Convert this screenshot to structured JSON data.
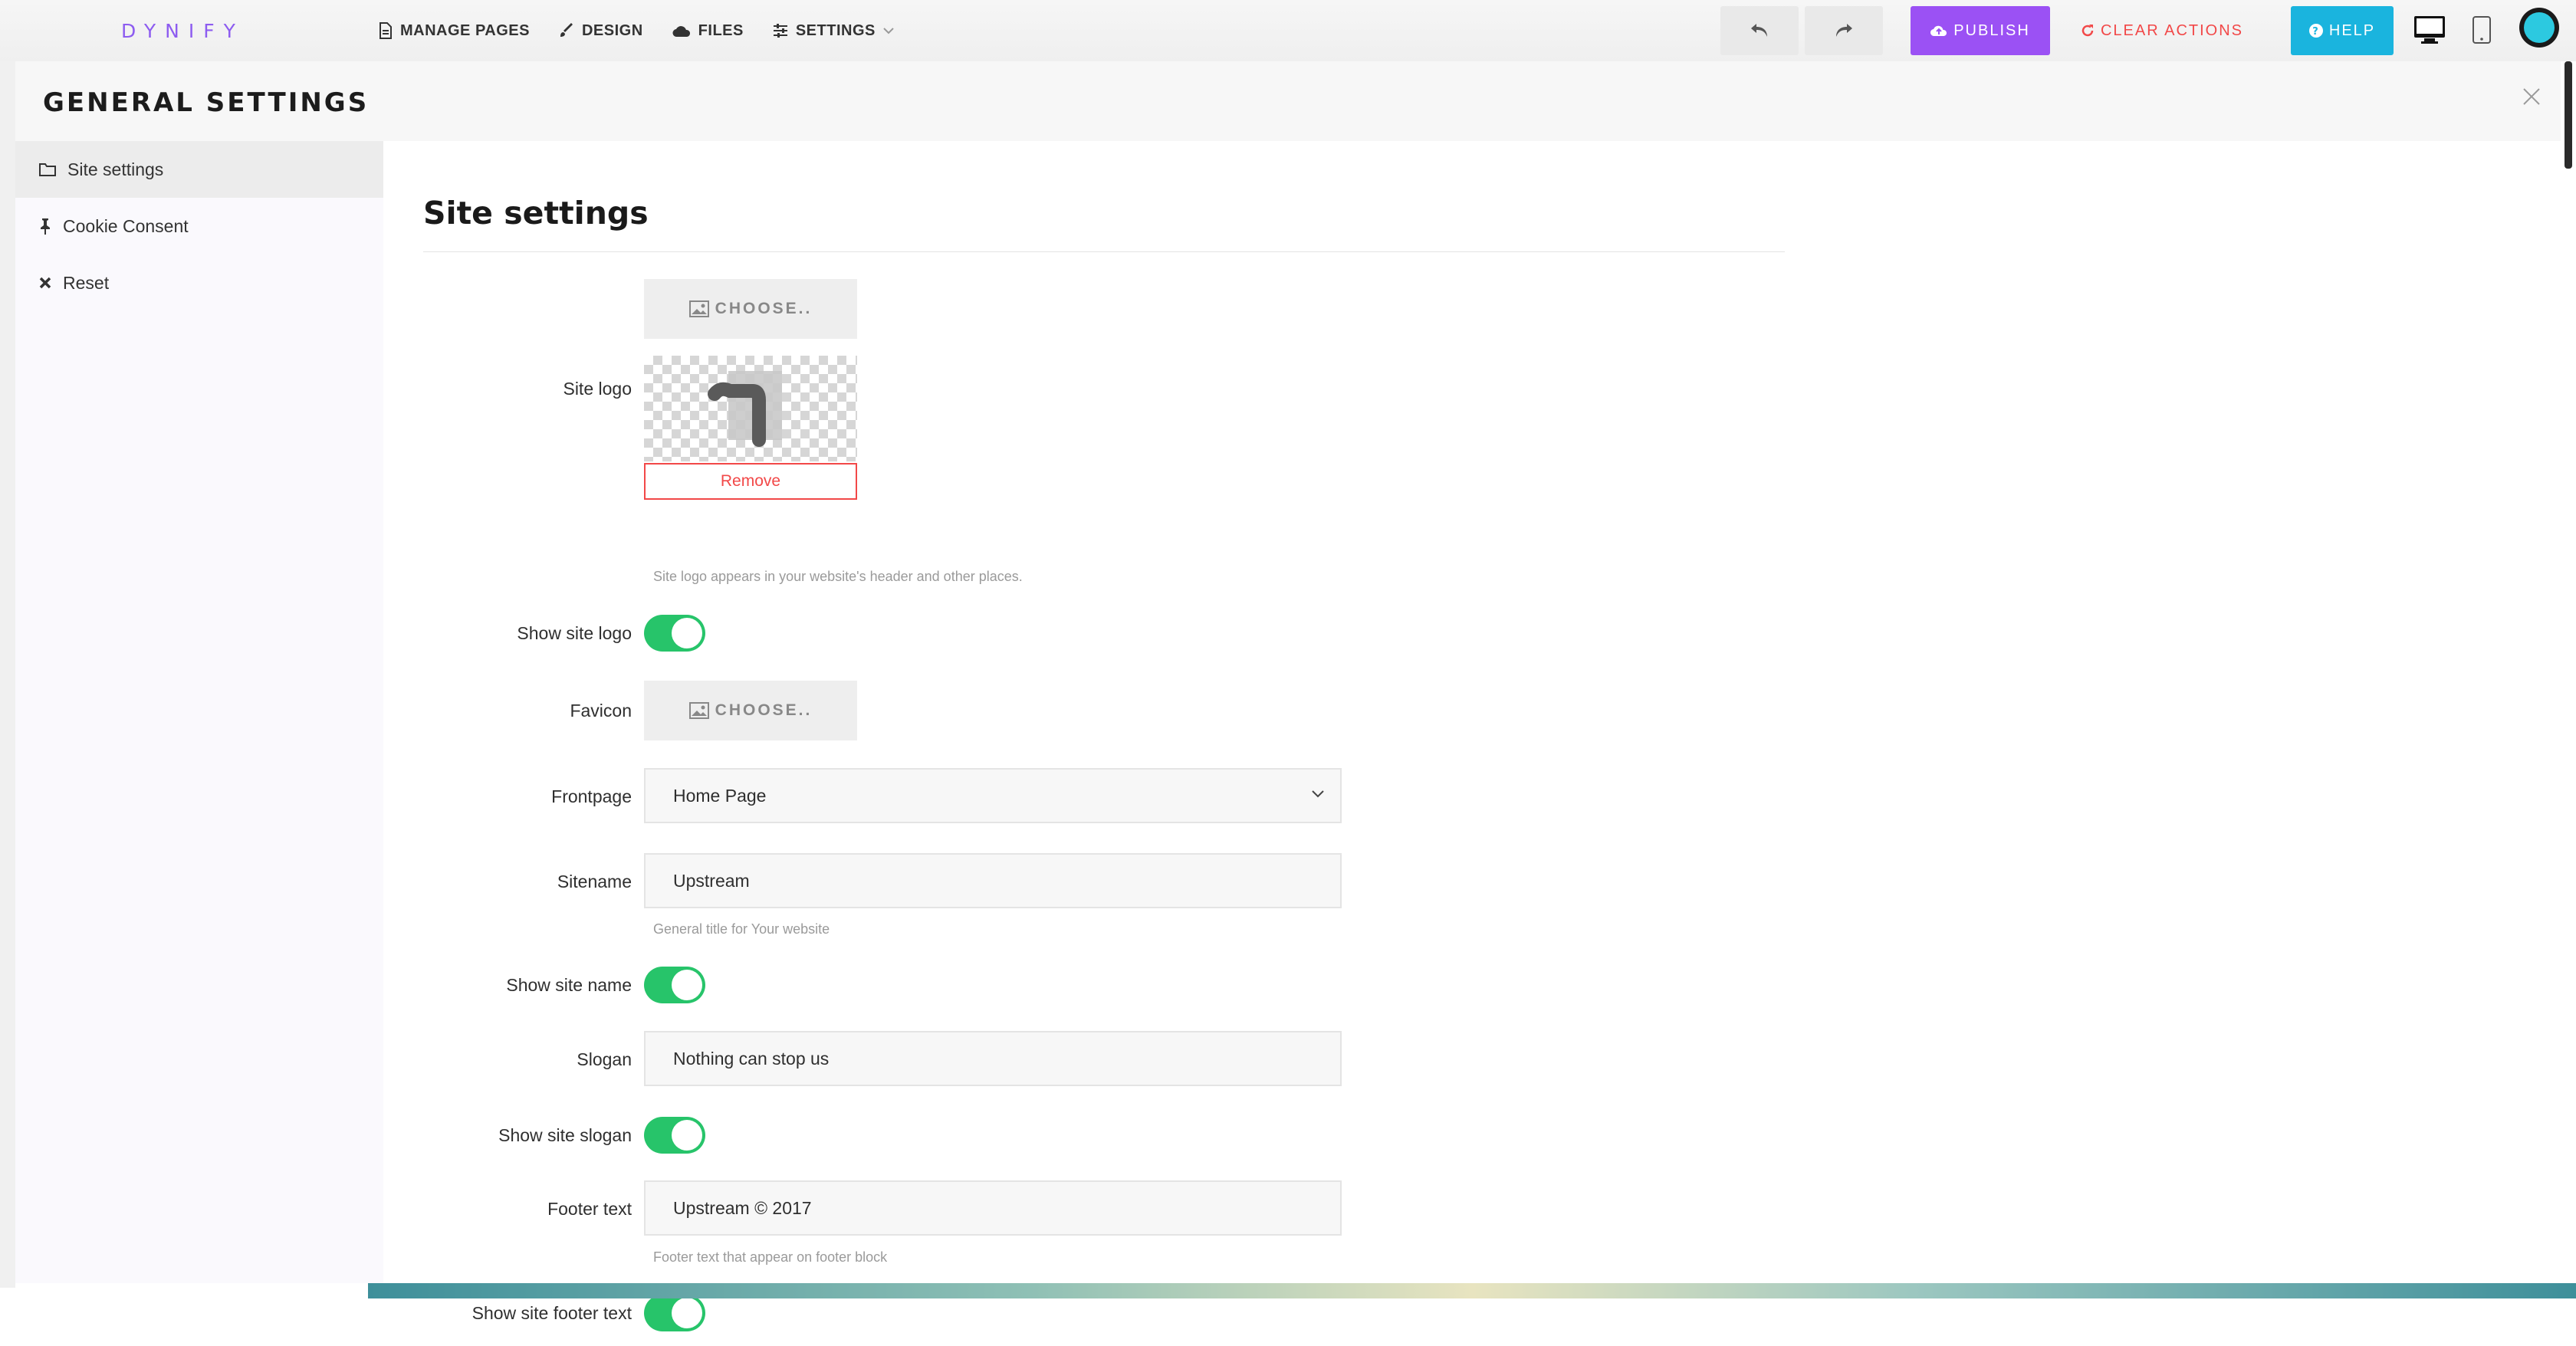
{
  "brand": "DYNIFY",
  "topbar": {
    "menu": [
      {
        "label": "MANAGE PAGES",
        "icon": "page-icon"
      },
      {
        "label": "DESIGN",
        "icon": "brush-icon"
      },
      {
        "label": "FILES",
        "icon": "cloud-icon"
      },
      {
        "label": "SETTINGS",
        "icon": "sliders-icon"
      }
    ],
    "publish_label": "PUBLISH",
    "clear_label": "CLEAR ACTIONS",
    "help_label": "HELP"
  },
  "colors": {
    "brand": "#8d5cf0",
    "publish": "#9b51f4",
    "clear": "#f24848",
    "help": "#1ab4de",
    "toggle_on": "#27c46a"
  },
  "modal": {
    "title": "GENERAL SETTINGS",
    "sidebar": [
      {
        "label": "Site settings",
        "icon": "folder-icon",
        "active": true
      },
      {
        "label": "Cookie Consent",
        "icon": "pin-icon",
        "active": false
      },
      {
        "label": "Reset",
        "icon": "x-icon",
        "active": false
      }
    ],
    "section_title": "Site settings",
    "choose_label": "CHOOSE..",
    "remove_label": "Remove",
    "fields": {
      "site_logo": {
        "label": "Site logo",
        "help": "Site logo appears in your website's header and other places."
      },
      "show_site_logo": {
        "label": "Show site logo",
        "on": true
      },
      "favicon": {
        "label": "Favicon"
      },
      "frontpage": {
        "label": "Frontpage",
        "value": "Home Page"
      },
      "sitename": {
        "label": "Sitename",
        "value": "Upstream",
        "help": "General title for Your website"
      },
      "show_site_name": {
        "label": "Show site name",
        "on": true
      },
      "slogan": {
        "label": "Slogan",
        "value": "Nothing can stop us"
      },
      "show_site_slogan": {
        "label": "Show site slogan",
        "on": true
      },
      "footer_text": {
        "label": "Footer text",
        "value": "Upstream © 2017",
        "help": "Footer text that appear on footer block"
      },
      "show_site_footer_text": {
        "label": "Show site footer text",
        "on": true
      }
    }
  }
}
